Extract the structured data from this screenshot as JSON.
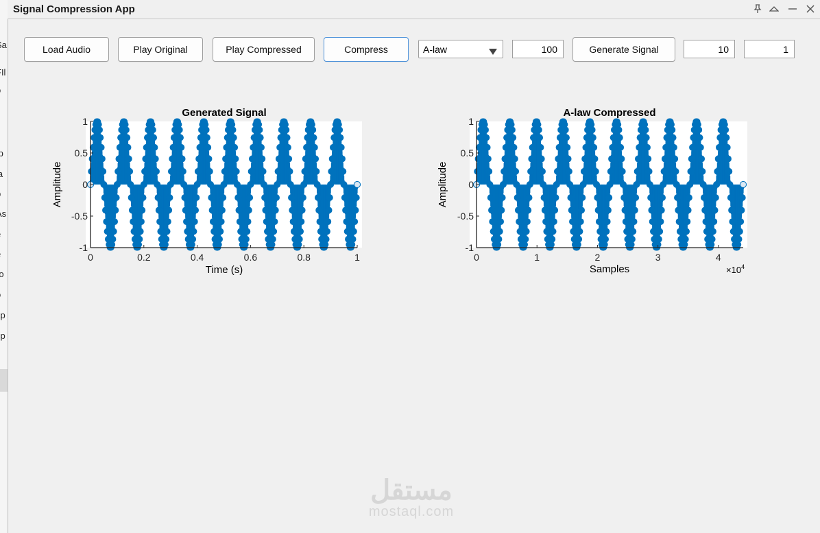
{
  "window": {
    "title": "Signal Compression App"
  },
  "background_app": {
    "fragments": [
      "Sa",
      "FIl",
      "o",
      ".p",
      "la",
      "p",
      "As",
      "e",
      "e",
      "ro",
      "o",
      "xp",
      "sp"
    ]
  },
  "toolbar": {
    "load_audio": "Load Audio",
    "play_original": "Play Original",
    "play_compressed": "Play Compressed",
    "compress": "Compress",
    "method": "A-law",
    "param_value": "100",
    "generate_signal": "Generate Signal",
    "freq_value": "10",
    "duration_value": "1"
  },
  "colors": {
    "series": "#0072bd",
    "accent_border": "#4a90d9"
  },
  "watermark": {
    "arabic": "مستقل",
    "latin": "mostaql.com"
  },
  "chart_data": [
    {
      "type": "scatter",
      "title": "Generated Signal",
      "xlabel": "Time (s)",
      "ylabel": "Amplitude",
      "xlim": [
        0,
        1
      ],
      "ylim": [
        -1,
        1
      ],
      "xticks": [
        "0",
        "0.2",
        "0.4",
        "0.6",
        "0.8",
        "1"
      ],
      "yticks": [
        "-1",
        "-0.5",
        "0",
        "0.5",
        "1"
      ],
      "signal": {
        "function": "sin",
        "cycles": 10,
        "amplitude": 1
      },
      "x_multiplier": ""
    },
    {
      "type": "scatter",
      "title": "A-law Compressed",
      "xlabel": "Samples",
      "ylabel": "Amplitude",
      "xlim": [
        0,
        44100
      ],
      "ylim": [
        -1,
        1
      ],
      "xticks": [
        "0",
        "1",
        "2",
        "3",
        "4"
      ],
      "yticks": [
        "-1",
        "-0.5",
        "0",
        "0.5",
        "1"
      ],
      "signal": {
        "function": "sin",
        "cycles": 10,
        "amplitude": 1
      },
      "x_multiplier": "×10",
      "x_multiplier_exp": "4"
    }
  ]
}
